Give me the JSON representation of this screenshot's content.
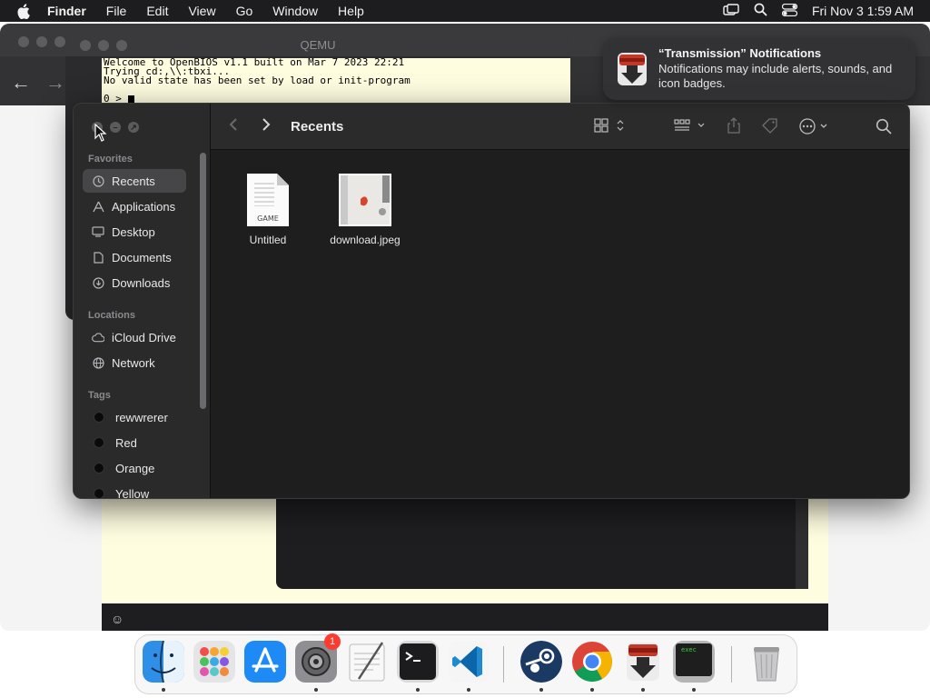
{
  "menubar": {
    "app_name": "Finder",
    "menus": [
      "File",
      "Edit",
      "View",
      "Go",
      "Window",
      "Help"
    ],
    "clock": "Fri Nov 3  1:59 AM"
  },
  "qemu": {
    "title": "QEMU",
    "lines": [
      "Welcome to OpenBIOS v1.1 built on Mar 7 2023 22:21",
      "Trying cd:,\\\\:tbxi...",
      "No valid state has been set by load or init-program",
      "",
      "0 > "
    ]
  },
  "notification": {
    "title": "“Transmission” Notifications",
    "body": "Notifications may include alerts, sounds, and icon badges."
  },
  "finder": {
    "title": "Recents",
    "sidebar": {
      "favorites_header": "Favorites",
      "favorites": [
        {
          "label": "Recents",
          "icon": "clock-icon",
          "active": true
        },
        {
          "label": "Applications",
          "icon": "applications-icon"
        },
        {
          "label": "Desktop",
          "icon": "desktop-icon"
        },
        {
          "label": "Documents",
          "icon": "document-icon"
        },
        {
          "label": "Downloads",
          "icon": "download-icon"
        }
      ],
      "locations_header": "Locations",
      "locations": [
        {
          "label": "iCloud Drive",
          "icon": "cloud-icon"
        },
        {
          "label": "Network",
          "icon": "globe-icon"
        }
      ],
      "tags_header": "Tags",
      "tags": [
        {
          "label": "rewwrerer"
        },
        {
          "label": "Red"
        },
        {
          "label": "Orange"
        },
        {
          "label": "Yellow"
        }
      ]
    },
    "files": [
      {
        "name": "Untitled",
        "type_label": "GAME"
      },
      {
        "name": "download.jpeg"
      }
    ]
  },
  "dock": {
    "items": [
      {
        "name": "Finder",
        "icon": "finder-icon",
        "running": true
      },
      {
        "name": "Launchpad",
        "icon": "launchpad-icon"
      },
      {
        "name": "App Store",
        "icon": "app-store-icon"
      },
      {
        "name": "System Settings",
        "icon": "settings-icon",
        "badge": "1",
        "running": true
      },
      {
        "name": "TextEdit",
        "icon": "textedit-icon"
      },
      {
        "name": "Terminal",
        "icon": "terminal-icon",
        "running": true
      },
      {
        "name": "Visual Studio Code",
        "icon": "vscode-icon",
        "running": true
      },
      {
        "name": "Steam",
        "icon": "steam-icon",
        "running": true
      },
      {
        "name": "Google Chrome",
        "icon": "chrome-icon",
        "running": true
      },
      {
        "name": "Transmission",
        "icon": "transmission-icon",
        "running": true
      },
      {
        "name": "exec",
        "icon": "exec-icon",
        "label_text": "exec",
        "running": true
      },
      {
        "name": "Trash",
        "icon": "trash-icon"
      }
    ]
  },
  "status_strip": {
    "emoji": "☺"
  },
  "colors": {
    "menubar_bg": "#1d1d1f",
    "finder_bg": "#1e1e1e",
    "sidebar_bg": "#2a2a2a",
    "sidebar_active": "#464649",
    "qemu_screen": "#fffde0",
    "badge_red": "#ff3b30"
  }
}
